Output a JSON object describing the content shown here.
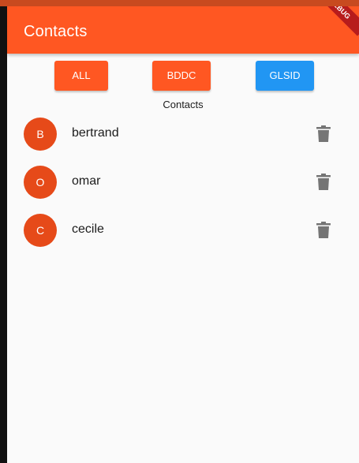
{
  "app_bar": {
    "title": "Contacts",
    "debug_banner": "DEBUG"
  },
  "filters": [
    {
      "label": "ALL",
      "color": "#ff5722"
    },
    {
      "label": "BDDC",
      "color": "#ff5722"
    },
    {
      "label": "GLSID",
      "color": "#2196f3"
    }
  ],
  "section_label": "Contacts",
  "contacts": [
    {
      "initial": "B",
      "name": "bertrand",
      "avatar_color": "#e64a19",
      "action_icon": "delete-icon"
    },
    {
      "initial": "O",
      "name": "omar",
      "avatar_color": "#e64a19",
      "action_icon": "delete-icon"
    },
    {
      "initial": "C",
      "name": "cecile",
      "avatar_color": "#e64a19",
      "action_icon": "delete-icon"
    }
  ],
  "colors": {
    "primary": "#ff5722",
    "secondary": "#2196f3",
    "background": "#fafafa",
    "icon_gray": "#757575"
  }
}
